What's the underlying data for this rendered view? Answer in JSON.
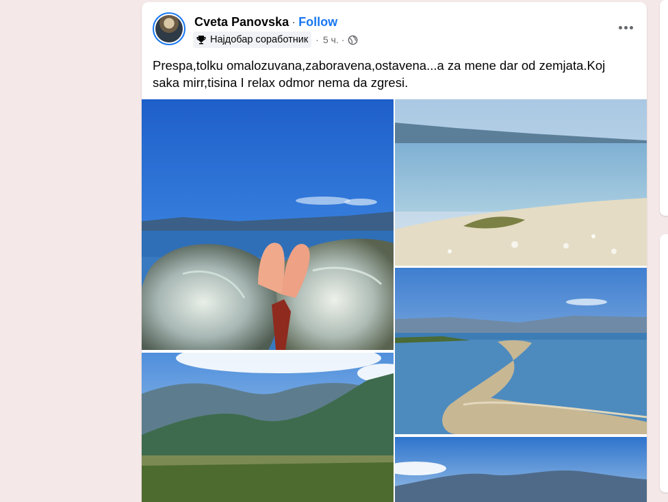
{
  "post": {
    "author": "Cveta Panovska",
    "separator": "·",
    "follow_label": "Follow",
    "badge_label": "Најдобар соработник",
    "badge_icon": "trophy-icon",
    "time": "5 ч.",
    "dot": "·",
    "privacy_icon": "globe-icon",
    "more_icon": "more-options-icon",
    "text": "Prespa,tolku omalozuvana,zaboravena,ostavena...a za mene dar od zemjata.Koj saka mirr,tisina I relax odmor nema da zgresi.",
    "photos": [
      {
        "subject": "open shell held in hand by the lake"
      },
      {
        "subject": "sandy beach at the lake shore"
      },
      {
        "subject": "green mountains above the valley"
      },
      {
        "subject": "sand spit stretching into the lake"
      },
      {
        "subject": "lake with mountains under blue sky"
      }
    ]
  },
  "colors": {
    "page_background": "#f5e8e8",
    "accent": "#1877f2",
    "text_primary": "#050505",
    "text_secondary": "#65676b"
  }
}
